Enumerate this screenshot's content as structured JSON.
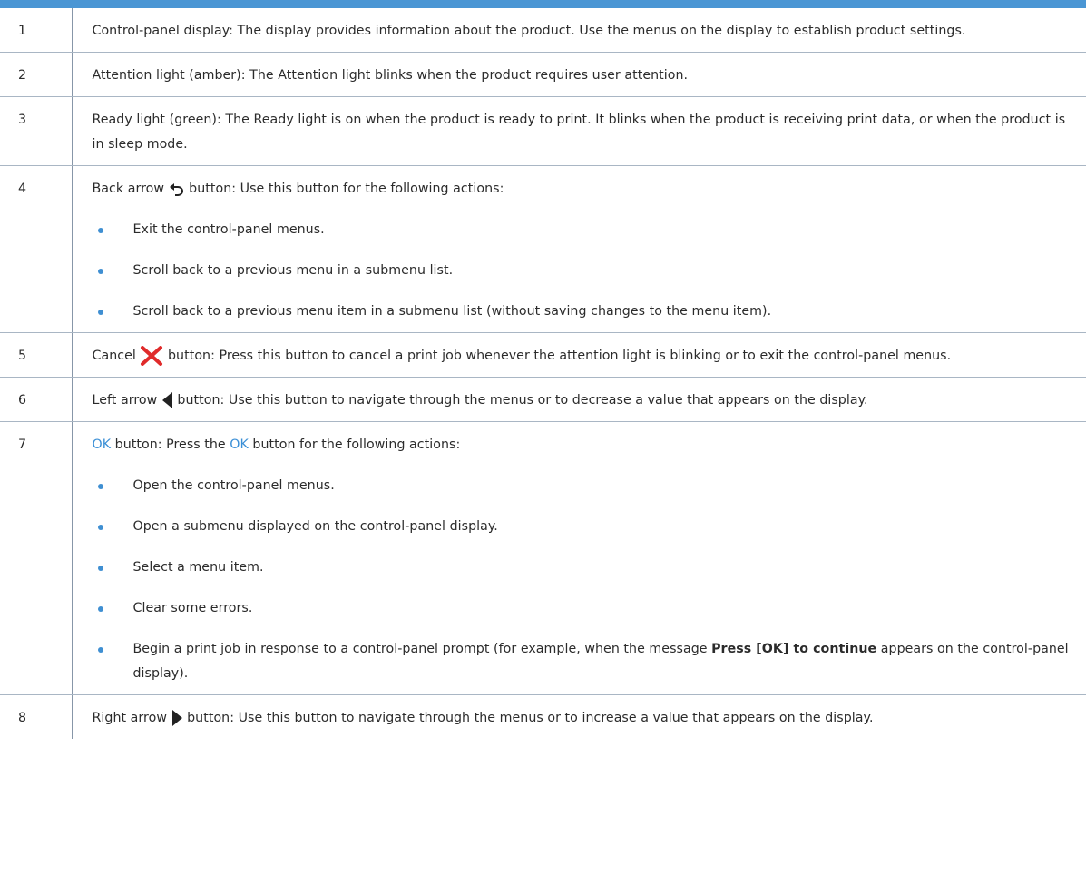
{
  "colors": {
    "accent": "#4a96d4",
    "bullet": "#3f8fd2",
    "ok_text": "#3b8fd6",
    "cancel_icon": "#e02b2b"
  },
  "rows": [
    {
      "num": "1",
      "text": "Control-panel display: The display provides information about the product. Use the menus on the display to establish product settings."
    },
    {
      "num": "2",
      "text": "Attention light (amber): The Attention light blinks when the product requires user attention."
    },
    {
      "num": "3",
      "text": "Ready light (green): The Ready light is on when the product is ready to print. It blinks when the product is receiving print data, or when the product is in sleep mode."
    },
    {
      "num": "4",
      "before_icon": "Back arrow ",
      "icon": "back-arrow-icon",
      "after_icon": " button: Use this button for the following actions:",
      "bullets": [
        "Exit the control-panel menus.",
        "Scroll back to a previous menu in a submenu list.",
        "Scroll back to a previous menu item in a submenu list (without saving changes to the menu item)."
      ]
    },
    {
      "num": "5",
      "before_icon": "Cancel ",
      "icon": "cancel-x-icon",
      "after_icon": " button: Press this button to cancel a print job whenever the attention light is blinking or to exit the control-panel menus."
    },
    {
      "num": "6",
      "before_icon": "Left arrow ",
      "icon": "left-arrow-icon",
      "after_icon": " button: Use this button to navigate through the menus or to decrease a value that appears on the display."
    },
    {
      "num": "7",
      "ok_label": "OK",
      "mid": " button: Press the ",
      "ok_label_2": "OK",
      "after": " button for the following actions:",
      "bullets": [
        "Open the control-panel menus.",
        "Open a submenu displayed on the control-panel display.",
        "Select a menu item.",
        "Clear some errors."
      ],
      "last_bullet": {
        "before": "Begin a print job in response to a control-panel prompt (for example, when the message ",
        "bold": "Press [OK] to continue",
        "after": " appears on the control-panel display)."
      }
    },
    {
      "num": "8",
      "before_icon": "Right arrow ",
      "icon": "right-arrow-icon",
      "after_icon": " button: Use this button to navigate through the menus or to increase a value that appears on the display."
    }
  ]
}
